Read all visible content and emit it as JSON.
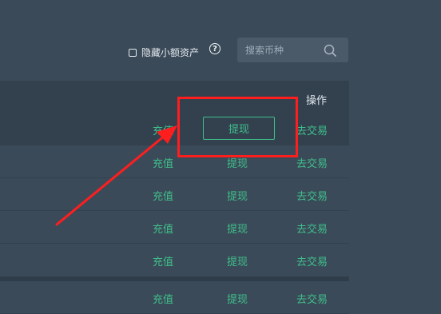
{
  "toolbar": {
    "hide_small_assets_label": "隐藏小额资产",
    "help_glyph": "?",
    "search": {
      "placeholder": "搜索币种",
      "value": ""
    }
  },
  "table": {
    "header": {
      "action": "操作"
    },
    "rows": [
      {
        "recharge": "充值",
        "withdraw": "提现",
        "trade": "去交易"
      },
      {
        "recharge": "充值",
        "withdraw": "提现",
        "trade": "去交易"
      },
      {
        "recharge": "充值",
        "withdraw": "提现",
        "trade": "去交易"
      },
      {
        "recharge": "充值",
        "withdraw": "提现",
        "trade": "去交易"
      },
      {
        "recharge": "充值",
        "withdraw": "提现",
        "trade": "去交易"
      },
      {
        "recharge": "充值",
        "withdraw": "提现",
        "trade": "去交易"
      }
    ]
  },
  "colors": {
    "background": "#3b4a58",
    "accent_green": "#3fbf8b",
    "annotation_red": "#ff1e1e"
  },
  "icons": [
    "search-icon",
    "help-icon",
    "checkbox-icon"
  ]
}
